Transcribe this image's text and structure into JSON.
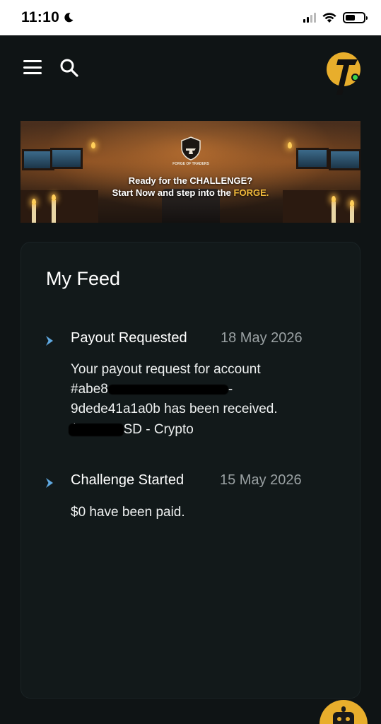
{
  "status_bar": {
    "time": "11:10",
    "icons": [
      "moon-icon",
      "cellular-signal-icon",
      "wifi-icon",
      "battery-icon"
    ]
  },
  "header": {
    "icons": [
      "hamburger-menu-icon",
      "search-icon",
      "user-avatar"
    ]
  },
  "banner": {
    "logo_text": "FORGE OF TRADERS",
    "line1": "Ready for the CHALLENGE?",
    "line2_prefix": "Start Now and step into the ",
    "line2_highlight": "FORGE."
  },
  "feed": {
    "title": "My Feed",
    "items": [
      {
        "title": "Payout Requested",
        "date": "18 May 2026",
        "body_line1": "Your payout request for account",
        "body_account_prefix": "#abe8",
        "body_account_suffix": "-",
        "body_line3": "9dede41a1a0b has been received.",
        "amount_prefix": "$",
        "amount_suffix": "SD - Crypto"
      },
      {
        "title": "Challenge Started",
        "date": "15 May 2026",
        "body": "$0 have been paid."
      }
    ]
  },
  "colors": {
    "background": "#0f1415",
    "card": "#12191a",
    "accent": "#e8ae2c",
    "arrow": "#5fa8e0",
    "muted": "#9aa1a3"
  }
}
